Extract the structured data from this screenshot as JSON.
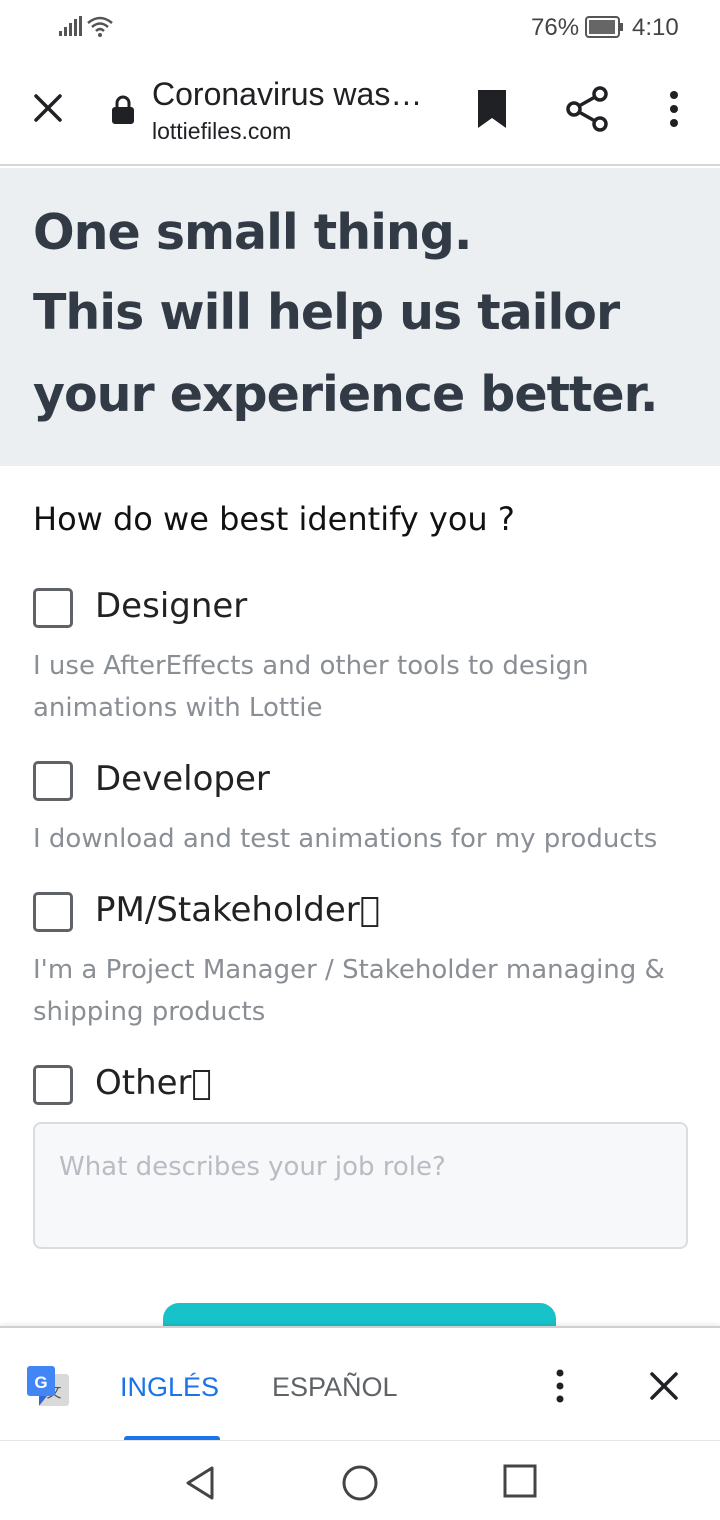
{
  "status_bar": {
    "battery_percent": "76%",
    "time": "4:10",
    "signal_icon": "signal-bars-icon",
    "wifi_icon": "wifi-icon",
    "battery_icon": "battery-icon"
  },
  "browser": {
    "page_title": "Coronavirus was…",
    "domain": "lottiefiles.com",
    "icons": [
      "close-icon",
      "lock-icon",
      "bookmark-icon",
      "share-icon",
      "more-vert-icon"
    ]
  },
  "hero": {
    "line1": "One small thing.",
    "line2": "This will help us tailor",
    "line3": "your experience better."
  },
  "form": {
    "question": "How do we best identify you ?",
    "options": [
      {
        "label": "Designer",
        "description": "I use AfterEffects and other tools to design animations with Lottie",
        "checked": false
      },
      {
        "label": "Developer",
        "description": "I download and test animations for my products",
        "checked": false
      },
      {
        "label": "PM/Stakeholder\u0000",
        "description": "I'm a Project Manager / Stakeholder managing & shipping products",
        "checked": false
      },
      {
        "label": "Other\u0000",
        "description": "",
        "checked": false
      }
    ],
    "job_role_placeholder": "What describes your job role?",
    "job_role_value": "",
    "submit_color": "#17c3c8"
  },
  "translate_bar": {
    "source_language": "INGLÉS",
    "target_language": "ESPAÑOL",
    "active_language": "INGLÉS",
    "accent_color": "#1a73e8"
  },
  "nav_bar": {
    "icons": [
      "back-triangle-icon",
      "home-circle-icon",
      "recents-square-icon"
    ]
  }
}
